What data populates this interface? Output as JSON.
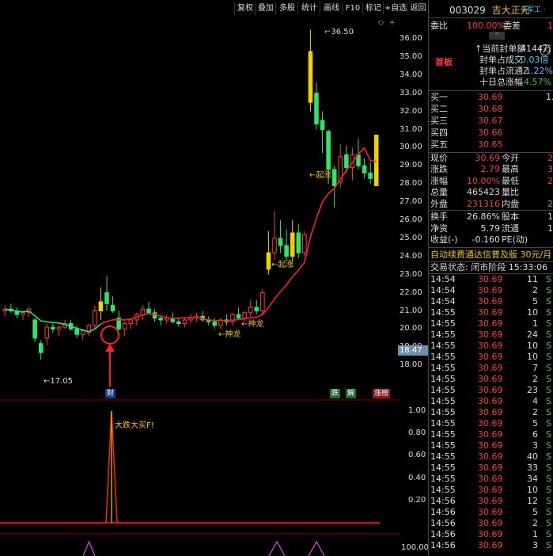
{
  "toolbar": {
    "buttons": [
      "复权",
      "叠加",
      "多股",
      "统计",
      "画线",
      "F10",
      "标记",
      "+自选",
      "返回"
    ]
  },
  "chart": {
    "price_ticks": [
      "36.00",
      "35.00",
      "34.00",
      "33.00",
      "32.00",
      "31.00",
      "30.00",
      "29.00",
      "28.00",
      "27.00",
      "26.00",
      "25.00",
      "24.00",
      "23.00",
      "22.00",
      "21.00",
      "20.00",
      "19.00",
      "18.00"
    ],
    "current_price_tag": "18.47",
    "high_label": "36.50",
    "low_label": "←17.05",
    "annotations": {
      "qizhang1": "←起涨",
      "qizhang2": "←起涨",
      "shenlong1": "←神龙",
      "shenlong2": "←神龙",
      "cai": "财",
      "die": "跌",
      "jie": "解",
      "zhangting": "涨榜"
    },
    "indicator_ticks": [
      "1.00",
      "0.80",
      "0.60",
      "0.40",
      "0.20"
    ],
    "indicator_label": "大跌大买F!",
    "lower_tick": "100.00",
    "colors": {
      "up": "#ff3b3b",
      "down": "#2ee56b",
      "ma": "#ff2020",
      "ma_early": "#2ee56b",
      "limit": "#f0d000"
    }
  },
  "panel": {
    "code": "003029",
    "name": "吉大正元",
    "tags": "③军工 ·",
    "weibi_label": "委比",
    "weibi_value": "100.00%",
    "weicha_label": "委差",
    "weicha_value": "1",
    "shouban": "首板",
    "seal_amount_label": "↑当前封单额",
    "seal_amount": "4144万",
    "seal_deal_label": "封单占成交",
    "seal_deal": "0.03倍",
    "seal_float_label": "封单占流通Z",
    "seal_float": "1.22%",
    "ten_day_label": "十日总涨幅",
    "ten_day": "-4.57%",
    "bids": [
      {
        "label": "买一",
        "price": "30.69",
        "vol": "1."
      },
      {
        "label": "买二",
        "price": "30.68",
        "vol": ""
      },
      {
        "label": "买三",
        "price": "30.67",
        "vol": ""
      },
      {
        "label": "买四",
        "price": "30.66",
        "vol": ""
      },
      {
        "label": "买五",
        "price": "30.65",
        "vol": ""
      }
    ],
    "stats": [
      {
        "l1": "现价",
        "v1": "30.69",
        "l2": "今开",
        "v2": "2"
      },
      {
        "l1": "涨跌",
        "v1": "2.79",
        "l2": "最高",
        "v2": "3"
      },
      {
        "l1": "涨幅",
        "v1": "10.00%",
        "l2": "最低",
        "v2": "2"
      },
      {
        "l1": "总量",
        "v1": "465423",
        "l2": "量比",
        "v2": ""
      },
      {
        "l1": "外盘",
        "v1": "231316",
        "l2": "内盘",
        "v2": "23"
      }
    ],
    "stats2": [
      {
        "l1": "换手",
        "v1": "26.86%",
        "l2": "股本",
        "v2": "1."
      },
      {
        "l1": "净资",
        "v1": "5.79",
        "l2": "流通",
        "v2": "1."
      },
      {
        "l1": "收益(-)",
        "v1": "-0.160",
        "l2": "PE(动)",
        "v2": ""
      }
    ],
    "ad": "自动续费通达信普及版  30元/月",
    "trade_status": "交易状态: 闭市阶段 15:33:06",
    "ticks": [
      {
        "t": "14:54",
        "p": "30.69",
        "v": "11",
        "s": "S"
      },
      {
        "t": "14:54",
        "p": "30.69",
        "v": "2",
        "s": "S"
      },
      {
        "t": "14:54",
        "p": "30.69",
        "v": "5",
        "s": "S"
      },
      {
        "t": "14:55",
        "p": "30.69",
        "v": "10",
        "s": "S"
      },
      {
        "t": "14:55",
        "p": "30.69",
        "v": "1",
        "s": "S"
      },
      {
        "t": "14:55",
        "p": "30.69",
        "v": "24",
        "s": "S"
      },
      {
        "t": "14:55",
        "p": "30.69",
        "v": "10",
        "s": "S"
      },
      {
        "t": "14:55",
        "p": "30.69",
        "v": "10",
        "s": "S"
      },
      {
        "t": "14:55",
        "p": "30.69",
        "v": "7",
        "s": "S"
      },
      {
        "t": "14:55",
        "p": "30.69",
        "v": "2",
        "s": "S"
      },
      {
        "t": "14:55",
        "p": "30.69",
        "v": "23",
        "s": "S"
      },
      {
        "t": "14:55",
        "p": "30.69",
        "v": "4",
        "s": "S"
      },
      {
        "t": "14:55",
        "p": "30.69",
        "v": "2",
        "s": "S"
      },
      {
        "t": "14:55",
        "p": "30.69",
        "v": "5",
        "s": "S"
      },
      {
        "t": "14:55",
        "p": "30.69",
        "v": "6",
        "s": "S"
      },
      {
        "t": "14:55",
        "p": "30.69",
        "v": "3",
        "s": "S"
      },
      {
        "t": "14:55",
        "p": "30.69",
        "v": "40",
        "s": "S"
      },
      {
        "t": "14:55",
        "p": "30.69",
        "v": "33",
        "s": "S"
      },
      {
        "t": "14:55",
        "p": "30.69",
        "v": "34",
        "s": "S"
      },
      {
        "t": "14:55",
        "p": "30.69",
        "v": "10",
        "s": "S"
      },
      {
        "t": "14:56",
        "p": "30.69",
        "v": "12",
        "s": "S"
      },
      {
        "t": "14:56",
        "p": "30.69",
        "v": "5",
        "s": "S"
      },
      {
        "t": "14:56",
        "p": "30.69",
        "v": "2",
        "s": "S"
      },
      {
        "t": "14:56",
        "p": "30.69",
        "v": "1",
        "s": "S"
      },
      {
        "t": "14:56",
        "p": "30.69",
        "v": "3",
        "s": "S"
      }
    ]
  }
}
